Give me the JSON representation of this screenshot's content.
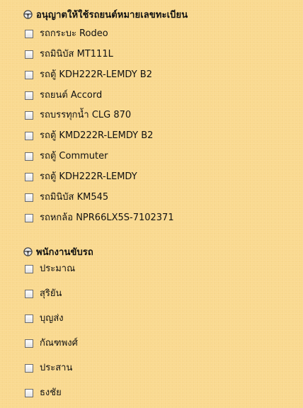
{
  "vehicles_section": {
    "title": "อนุญาตให้ใช้รถยนต์หมายเลขทะเบียน",
    "icon": "steering-wheel-icon",
    "items": [
      {
        "label": "รถกระบะ Rodeo",
        "checked": false
      },
      {
        "label": "รถมินิบัส MT111L",
        "checked": false
      },
      {
        "label": "รถตู้ KDH222R-LEMDY B2",
        "checked": false
      },
      {
        "label": "รถยนต์ Accord",
        "checked": false
      },
      {
        "label": "รถบรรทุกน้ำ CLG 870",
        "checked": false
      },
      {
        "label": "รถตู้ KMD222R-LEMDY B2",
        "checked": false
      },
      {
        "label": "รถตู้ Commuter",
        "checked": false
      },
      {
        "label": "รถตู้ KDH222R-LEMDY",
        "checked": false
      },
      {
        "label": "รถมินิบัส KM545",
        "checked": false
      },
      {
        "label": "รถหกล้อ NPR66LX5S-7102371",
        "checked": false
      }
    ]
  },
  "drivers_section": {
    "title": "พนักงานขับรถ",
    "icon": "steering-wheel-icon",
    "items": [
      {
        "label": "ประมาณ",
        "checked": false
      },
      {
        "label": "สุริยัน",
        "checked": false
      },
      {
        "label": "บุญส่ง",
        "checked": false
      },
      {
        "label": "กัณฑพงศ์",
        "checked": false
      },
      {
        "label": "ประสาน",
        "checked": false
      },
      {
        "label": "ธงชัย",
        "checked": false
      }
    ]
  },
  "colors": {
    "background": "#f9d98f",
    "text": "#111111",
    "checkbox_border": "#6b6b6b"
  }
}
